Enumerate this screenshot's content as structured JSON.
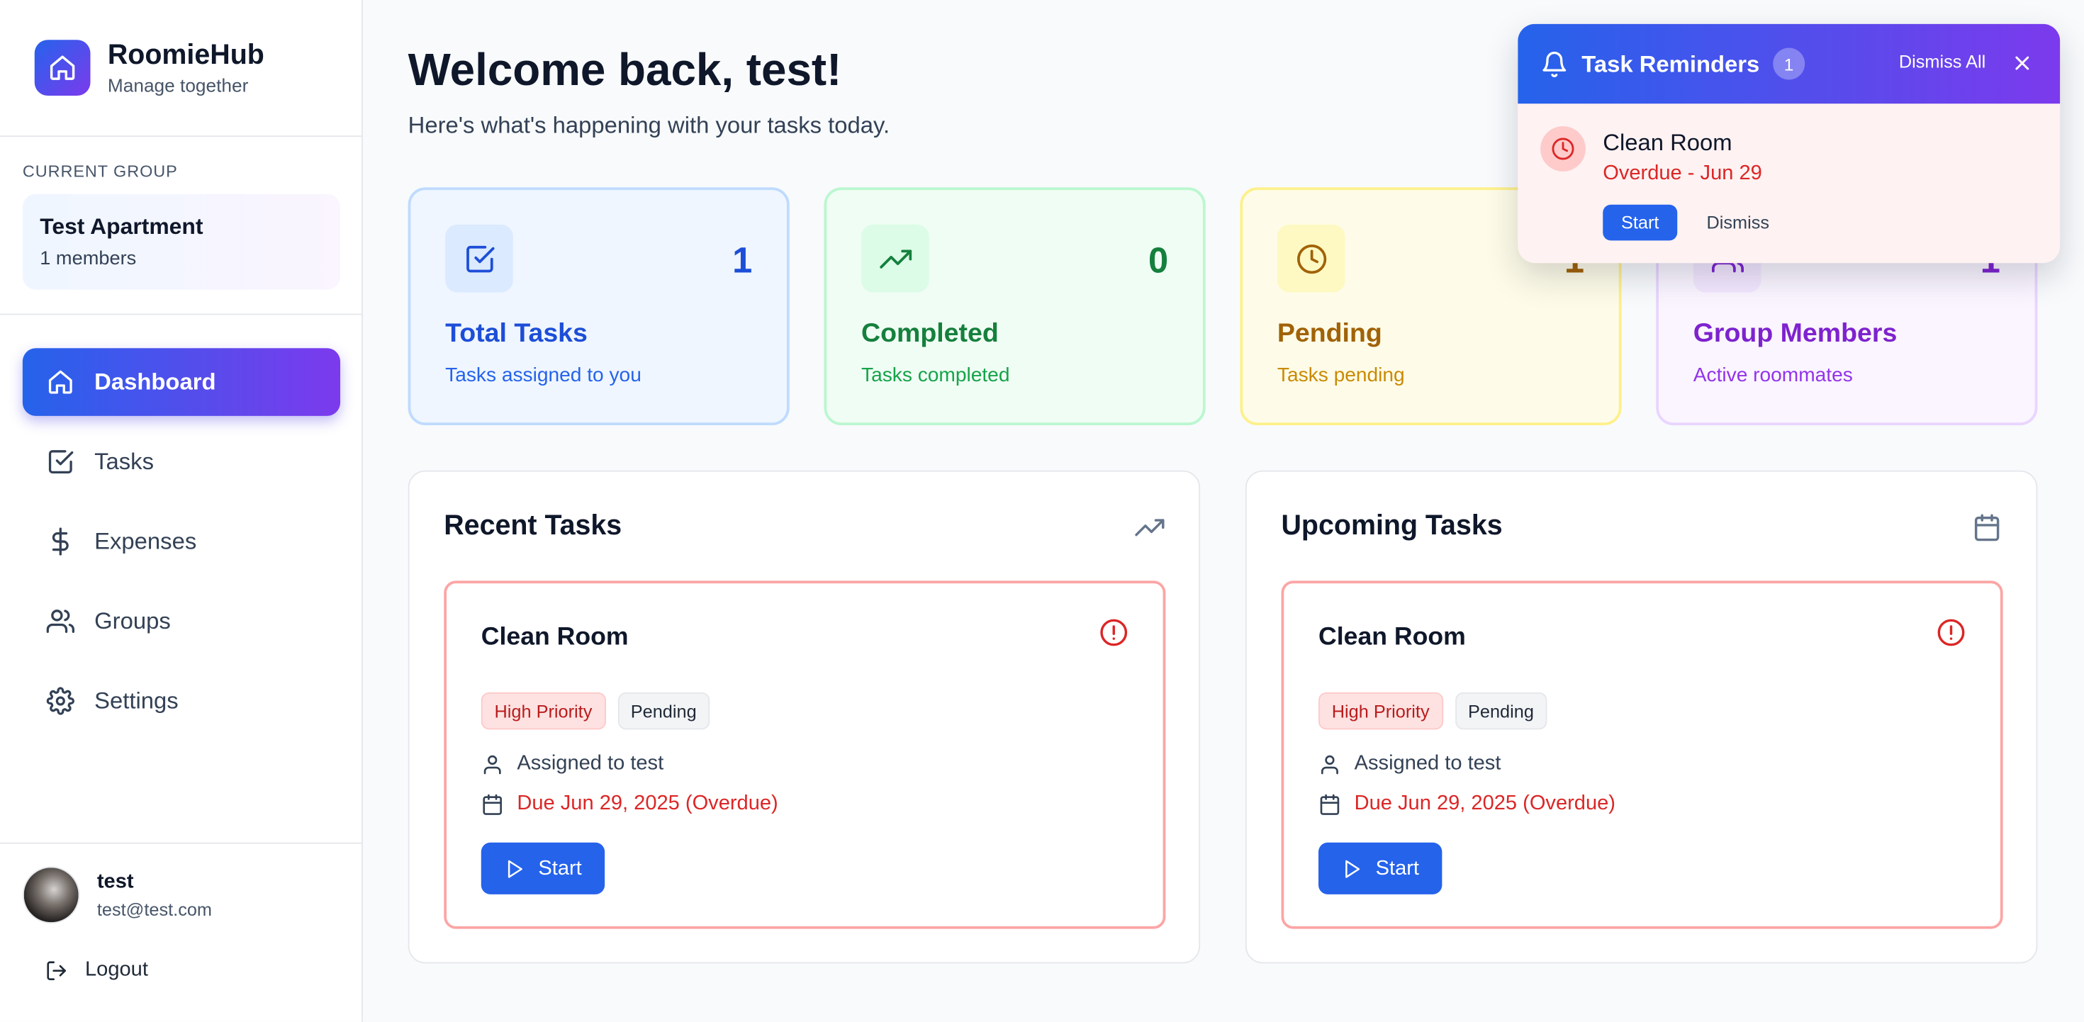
{
  "app": {
    "name": "RoomieHub",
    "tagline": "Manage together"
  },
  "sidebar": {
    "current_group_label": "CURRENT GROUP",
    "group_name": "Test Apartment",
    "group_members": "1 members",
    "items": [
      {
        "label": "Dashboard",
        "icon": "home-icon",
        "active": true
      },
      {
        "label": "Tasks",
        "icon": "checkbox-icon",
        "active": false
      },
      {
        "label": "Expenses",
        "icon": "dollar-icon",
        "active": false
      },
      {
        "label": "Groups",
        "icon": "users-icon",
        "active": false
      },
      {
        "label": "Settings",
        "icon": "gear-icon",
        "active": false
      }
    ],
    "user": {
      "name": "test",
      "email": "test@test.com"
    },
    "logout_label": "Logout"
  },
  "header": {
    "title": "Welcome back, test!",
    "subtitle": "Here's what's happening with your tasks today."
  },
  "stats": [
    {
      "title": "Total Tasks",
      "value": "1",
      "desc": "Tasks assigned to you",
      "color": "#1d4ed8"
    },
    {
      "title": "Completed",
      "value": "0",
      "desc": "Tasks completed",
      "color": "#15803d"
    },
    {
      "title": "Pending",
      "value": "1",
      "desc": "Tasks pending",
      "color": "#a16207"
    },
    {
      "title": "Group Members",
      "value": "1",
      "desc": "Active roommates",
      "color": "#7e22ce"
    }
  ],
  "recent": {
    "title": "Recent Tasks",
    "task": {
      "title": "Clean Room",
      "priority": "High Priority",
      "status": "Pending",
      "assigned": "Assigned to test",
      "due": "Due Jun 29, 2025 (Overdue)",
      "start_label": "Start"
    }
  },
  "upcoming": {
    "title": "Upcoming Tasks",
    "task": {
      "title": "Clean Room",
      "priority": "High Priority",
      "status": "Pending",
      "assigned": "Assigned to test",
      "due": "Due Jun 29, 2025 (Overdue)",
      "start_label": "Start"
    }
  },
  "reminders": {
    "title": "Task Reminders",
    "count": "1",
    "dismiss_all_label": "Dismiss All",
    "item": {
      "task": "Clean Room",
      "due": "Overdue - Jun 29",
      "start_label": "Start",
      "dismiss_label": "Dismiss"
    }
  },
  "colors": {
    "accent_start": "#2563eb",
    "accent_end": "#7c3aed",
    "overdue": "#dc2626"
  }
}
